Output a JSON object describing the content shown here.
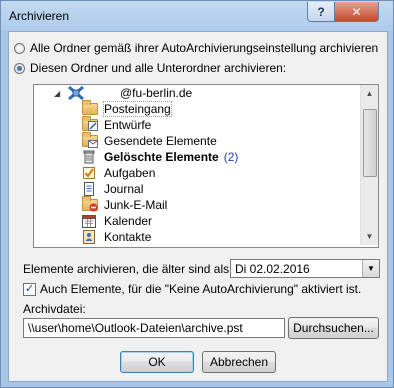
{
  "window": {
    "title": "Archivieren",
    "help_glyph": "?",
    "close_glyph": "✕"
  },
  "options": {
    "all_folders_label": "Alle Ordner gemäß ihrer AutoArchivierungseinstellung archivieren",
    "this_folder_label": "Diesen Ordner und alle Unterordner archivieren:"
  },
  "tree": {
    "root_label": "@fu-berlin.de",
    "expander": "◢",
    "items": [
      {
        "label": "Posteingang",
        "icon": "inbox-folder-icon"
      },
      {
        "label": "Entwürfe",
        "icon": "drafts-folder-icon"
      },
      {
        "label": "Gesendete Elemente",
        "icon": "sent-folder-icon"
      },
      {
        "label": "Gelöschte Elemente",
        "icon": "deleted-items-icon",
        "bold": true,
        "count": "(2)"
      },
      {
        "label": "Aufgaben",
        "icon": "tasks-icon"
      },
      {
        "label": "Journal",
        "icon": "journal-icon"
      },
      {
        "label": "Junk-E-Mail",
        "icon": "junk-folder-icon"
      },
      {
        "label": "Kalender",
        "icon": "calendar-icon"
      },
      {
        "label": "Kontakte",
        "icon": "contacts-icon"
      }
    ]
  },
  "older_than": {
    "label": "Elemente archivieren, die älter sind als:",
    "value": "Di 02.02.2016"
  },
  "include_checkbox": {
    "label": "Auch Elemente, für die \"Keine AutoArchivierung\" aktiviert ist.",
    "checked": true
  },
  "archive_file": {
    "label": "Archivdatei:",
    "value": "\\\\user\\home\\Outlook-Dateien\\archive.pst",
    "browse_label": "Durchsuchen..."
  },
  "buttons": {
    "ok": "OK",
    "cancel": "Abbrechen"
  },
  "colors": {
    "title_bar": "#aecbeb",
    "close_button": "#c44a30",
    "dialog_bg": "#f0f0f0"
  }
}
